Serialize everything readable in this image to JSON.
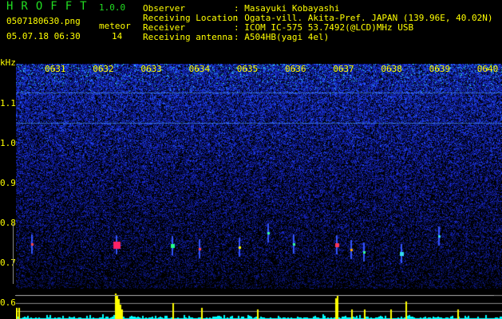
{
  "app": {
    "title": "HROFFT",
    "version": "1.0.0"
  },
  "file": {
    "name": "0507180630.png",
    "datetime": "05.07.18 06:30"
  },
  "meteor": {
    "label": "meteor",
    "count": "14"
  },
  "info": [
    {
      "label": "Observer",
      "value": "Masayuki Kobayashi"
    },
    {
      "label": "Receiving Location",
      "value": "Ogata-vill. Akita-Pref. JAPAN (139.96E, 40.02N)"
    },
    {
      "label": "Receiver",
      "value": "ICOM IC-575 53.7492(@LCD)MHz USB"
    },
    {
      "label": "Receiving antenna",
      "value": "A504HB(yagi 4el)"
    }
  ],
  "axis": {
    "unit": "kHz",
    "y_labels": [
      "1.1",
      "1.0",
      "0.9",
      "0.8",
      "0.7",
      "0.6"
    ],
    "time_labels": [
      "0631",
      "0632",
      "0633",
      "0634",
      "0635",
      "0636",
      "0637",
      "0638",
      "0639",
      "0640"
    ]
  },
  "colors": {
    "text": "#ffff00",
    "title": "#22dd22",
    "noise": "#1a2acc",
    "histogram": "#00ffff",
    "meteor_bar": "#ffff00"
  }
}
